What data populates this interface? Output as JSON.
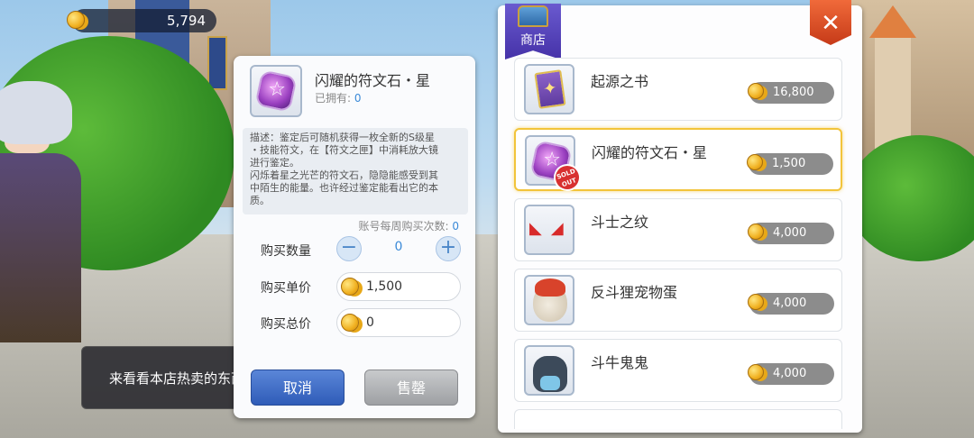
{
  "currency": {
    "gold": "5,794",
    "icon": "gold-coin-icon"
  },
  "toast": {
    "text": "来看看本店热卖的东西"
  },
  "detail": {
    "name": "闪耀的符文石・星",
    "owned_label": "已拥有:",
    "owned_value": "0",
    "description": [
      "描述：鉴定后可随机获得一枚全新的S级星",
      "・技能符文，在【符文之匣】中消耗放大镜",
      "进行鉴定。",
      "闪烁着星之光芒的符文石，隐隐能感受到其",
      "中陌生的能量。也许经过鉴定能看出它的本",
      "质。"
    ],
    "weekly_label": "账号每周购买次数:",
    "weekly_value": "0",
    "quantity_label": "购买数量",
    "quantity_value": "0",
    "unit_price_label": "购买单价",
    "unit_price_value": "1,500",
    "total_price_label": "购买总价",
    "total_price_value": "0",
    "cancel_label": "取消",
    "sold_out_label": "售罄"
  },
  "shop": {
    "title": "商店",
    "close_label": "✕",
    "items": [
      {
        "name": "起源之书",
        "price": "16,800",
        "icon": "origin-book-icon"
      },
      {
        "name": "闪耀的符文石・星",
        "price": "1,500",
        "icon": "rune-stone-star-icon",
        "selected": true,
        "sold_out": true,
        "stamp": "SOLD OUT"
      },
      {
        "name": "斗士之纹",
        "price": "4,000",
        "icon": "fighter-mark-icon"
      },
      {
        "name": "反斗狸宠物蛋",
        "price": "4,000",
        "icon": "pet-egg-icon"
      },
      {
        "name": "斗牛鬼鬼",
        "price": "4,000",
        "icon": "bull-ghost-icon"
      }
    ]
  },
  "colors": {
    "accent_blue": "#3b8ad8",
    "selected_border": "#f2c43a",
    "close_red": "#d8432b"
  }
}
